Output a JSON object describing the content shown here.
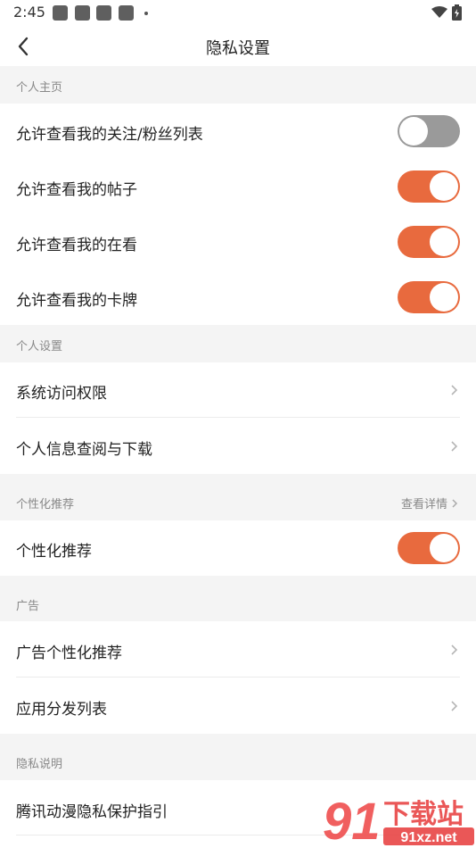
{
  "status": {
    "time": "2:45"
  },
  "nav": {
    "title": "隐私设置"
  },
  "sections": {
    "profile": {
      "header": "个人主页",
      "items": [
        {
          "label": "允许查看我的关注/粉丝列表",
          "toggle": "off"
        },
        {
          "label": "允许查看我的帖子",
          "toggle": "on"
        },
        {
          "label": "允许查看我的在看",
          "toggle": "on"
        },
        {
          "label": "允许查看我的卡牌",
          "toggle": "on"
        }
      ]
    },
    "personal": {
      "header": "个人设置",
      "items": [
        {
          "label": "系统访问权限"
        },
        {
          "label": "个人信息查阅与下载"
        }
      ]
    },
    "recommend": {
      "header": "个性化推荐",
      "header_link": "查看详情",
      "items": [
        {
          "label": "个性化推荐",
          "toggle": "on"
        }
      ]
    },
    "ads": {
      "header": "广告",
      "items": [
        {
          "label": "广告个性化推荐"
        },
        {
          "label": "应用分发列表"
        }
      ]
    },
    "privacy": {
      "header": "隐私说明",
      "items": [
        {
          "label": "腾讯动漫隐私保护指引"
        }
      ]
    }
  },
  "watermark": {
    "number": "91",
    "cn": "下载站",
    "url": "91xz.net"
  },
  "colors": {
    "accent": "#e86a3e",
    "toggle_off": "#9a9a9a",
    "section_bg": "#f4f4f4"
  }
}
